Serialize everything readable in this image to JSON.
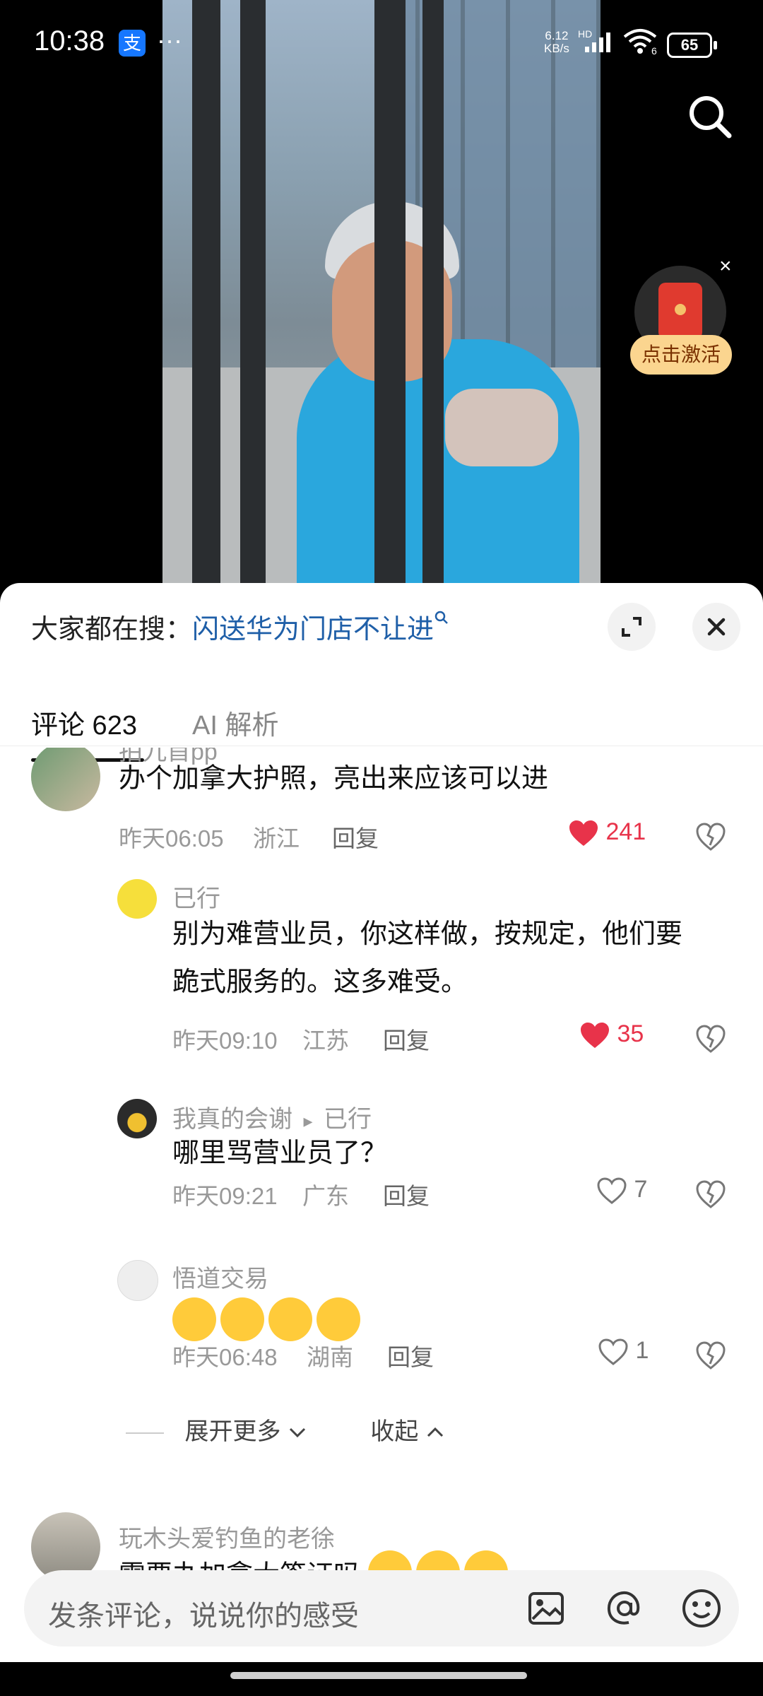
{
  "status_bar": {
    "time": "10:38",
    "alipay_glyph": "支",
    "more_glyph": "···",
    "net_speed": "6.12",
    "net_unit": "KB/s",
    "hd": "HD",
    "wifi_level": "6",
    "battery": "65"
  },
  "redpack": {
    "label": "点击激活",
    "close": "×"
  },
  "sheet": {
    "hot_search_prefix": "大家都在搜：",
    "hot_search_query": "闪送华为门店不让进"
  },
  "tabs": [
    {
      "label": "评论 623"
    },
    {
      "label": "AI 解析"
    }
  ],
  "comments": {
    "c1": {
      "name": "拍九首pp",
      "text": "办个加拿大护照，亮出来应该可以进",
      "time": "昨天06:05",
      "location": "浙江",
      "reply": "回复",
      "likes": "241"
    },
    "r1": {
      "name": "已行",
      "text_line1": "别为难营业员，你这样做，按规定，他们要",
      "text_line2": "跪式服务的。这多难受。",
      "time": "昨天09:10",
      "location": "江苏",
      "reply": "回复",
      "likes": "35"
    },
    "r2": {
      "name": "我真的会谢",
      "arrow": "▸",
      "reply_to": "已行",
      "text": "哪里骂营业员了？",
      "time": "昨天09:21",
      "location": "广东",
      "reply": "回复",
      "likes": "7"
    },
    "r3": {
      "name": "悟道交易",
      "time": "昨天06:48",
      "location": "湖南",
      "reply": "回复",
      "likes": "1"
    },
    "expand_more": "展开更多",
    "collapse": "收起",
    "c2": {
      "name": "玩木头爱钓鱼的老徐",
      "text": "需要办加拿大签证吗"
    }
  },
  "input": {
    "placeholder": "发条评论，说说你的感受"
  },
  "icons": {
    "search": "search-icon",
    "expand": "expand-icon",
    "close": "close-icon",
    "heart": "heart-icon",
    "dislike": "dislike-icon",
    "image": "image-icon",
    "at": "at-icon",
    "emoji": "emoji-icon"
  },
  "colors": {
    "like_red": "#e8334a",
    "link_blue": "#1f5fa8",
    "redpack_gold": "#fbd58f"
  }
}
